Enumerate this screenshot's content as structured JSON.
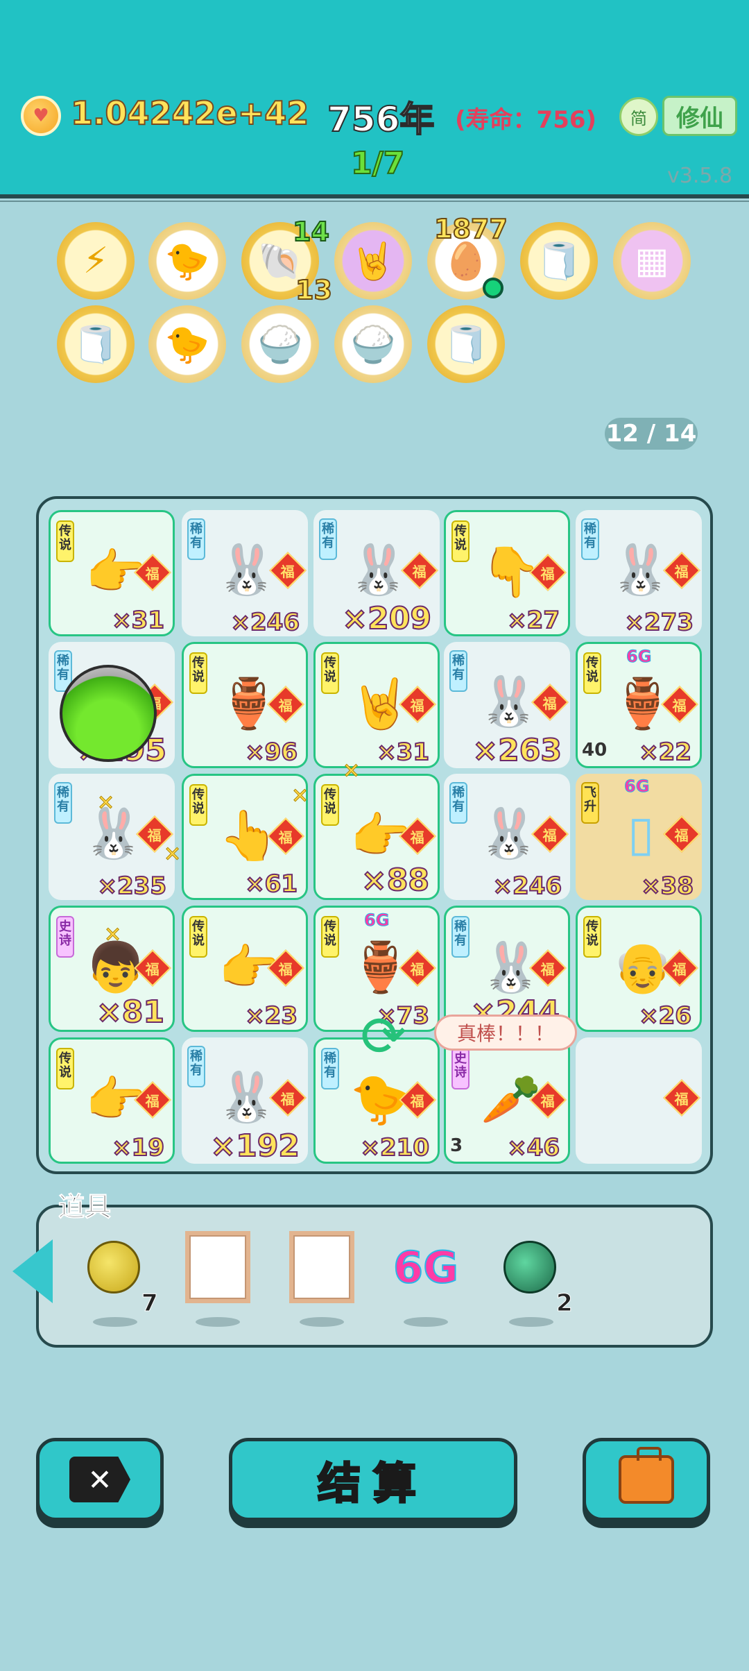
{
  "header": {
    "coins": "1.04242e+42",
    "year": "756年",
    "lifespan": "(寿命：756)",
    "simplified_btn": "简",
    "xiuxian_btn": "修仙",
    "progress": "1/7",
    "version": "v3.5.8"
  },
  "buffs": {
    "shell_top_count": "14",
    "shell_bottom_count": "13",
    "egg_tray_count": "1877"
  },
  "page_counter": "12 / 14",
  "board": {
    "rarity_legend": "传\n说",
    "rarity_rare": "稀\n有",
    "rarity_epic": "史\n诗",
    "rarity_ascend": "飞\n升",
    "fu": "福",
    "tag_6g": "6G",
    "cells": {
      "c0": "×31",
      "c1": "×246",
      "c2": "×209",
      "c3": "×27",
      "c4": "×273",
      "c5": "×195",
      "c6": "×96",
      "c7": "×31",
      "c8": "×263",
      "c9": "×22",
      "c10": "×235",
      "c11": "×61",
      "c12": "×88",
      "c13": "×246",
      "c14": "×38",
      "c15": "×81",
      "c16": "×23",
      "c17": "×73",
      "c18": "×244",
      "c19": "×26",
      "c20": "×19",
      "c21": "×192",
      "c22": "×210",
      "c23": "×46"
    },
    "corner_c9": "40",
    "corner_c23": "3",
    "bubble": "真棒！！！"
  },
  "props": {
    "title": "道具",
    "gold_orb_count": "7",
    "six_g": "6G",
    "green_orb_count": "2"
  },
  "buttons": {
    "settle": "结算"
  },
  "colors": {
    "header_bg": "#21c2c4",
    "page_bg": "#a8d6dc",
    "accent_gold": "#ffe35b",
    "legend_border": "#27c584",
    "fu_red": "#e73a2a"
  }
}
